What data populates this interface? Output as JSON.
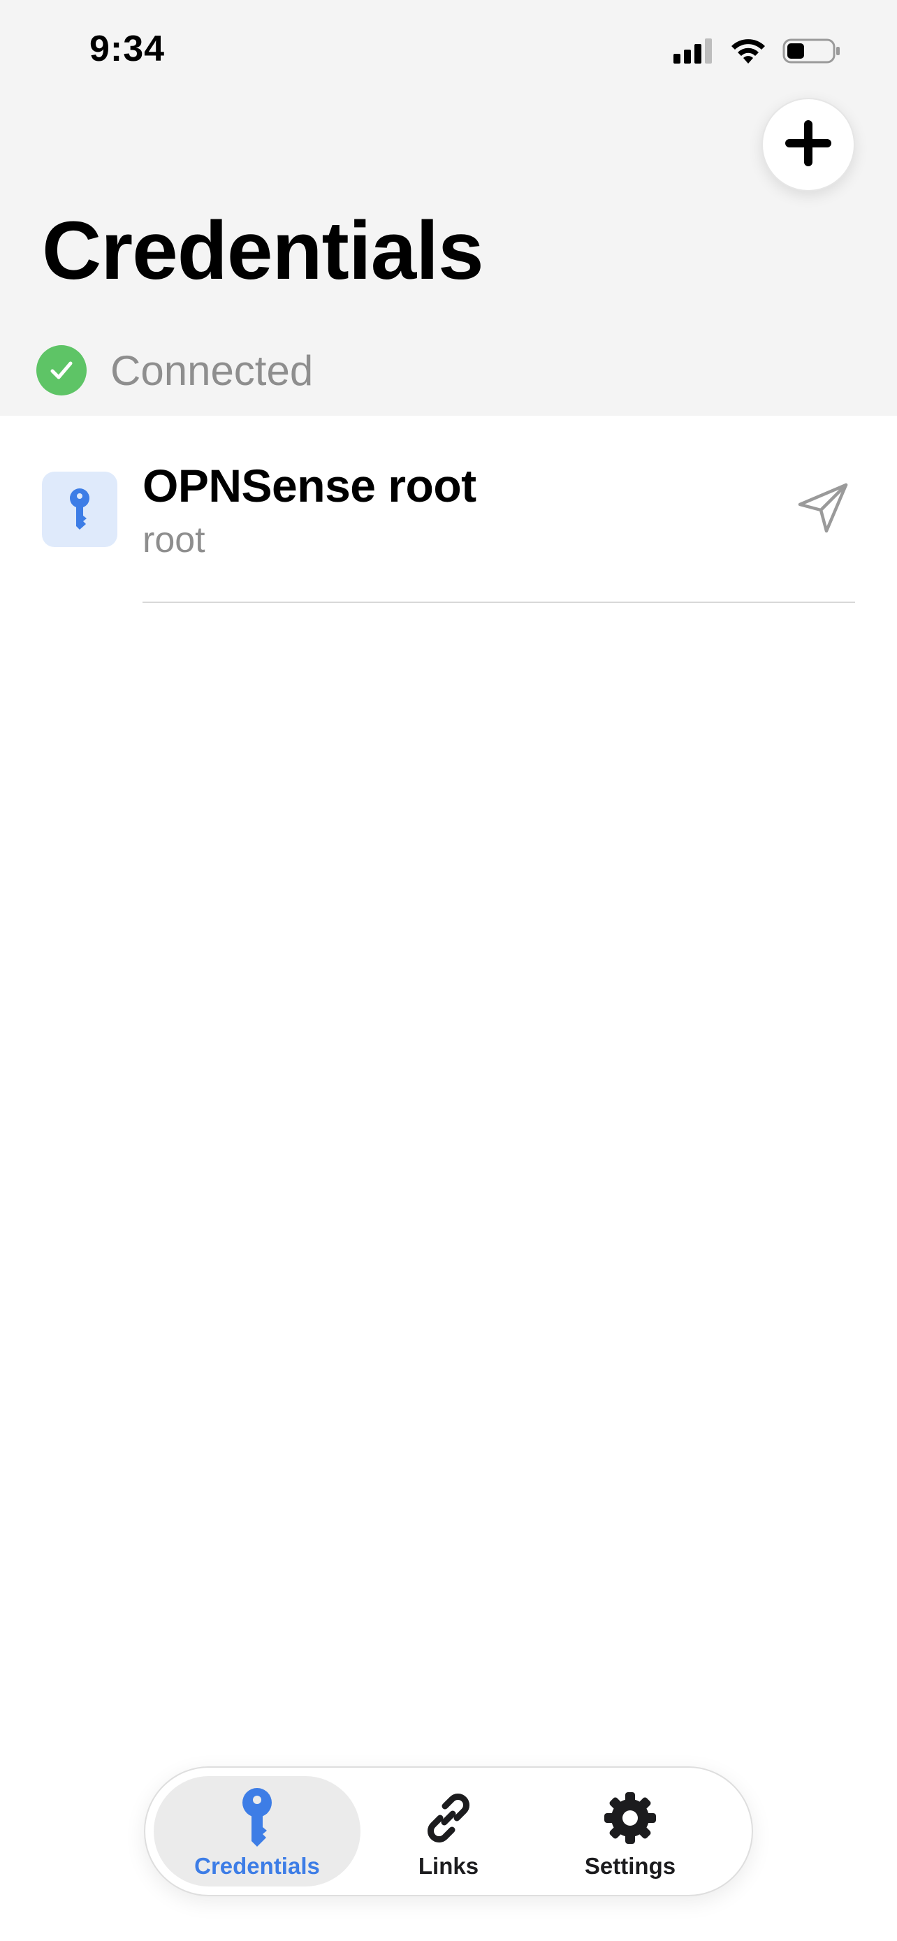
{
  "status_bar": {
    "time": "9:34"
  },
  "header": {
    "title": "Credentials",
    "connection_status": "Connected",
    "add_icon": "plus-icon"
  },
  "credentials": [
    {
      "title": "OPNSense root",
      "username": "root",
      "icon": "key-icon",
      "action_icon": "send-icon"
    }
  ],
  "tab_bar": {
    "tabs": [
      {
        "label": "Credentials",
        "icon": "key-icon",
        "active": true
      },
      {
        "label": "Links",
        "icon": "link-icon",
        "active": false
      },
      {
        "label": "Settings",
        "icon": "gear-icon",
        "active": false
      }
    ]
  },
  "colors": {
    "accent": "#3d7de6",
    "connected": "#5ec466",
    "header_bg": "#f4f4f4",
    "key_tile_bg": "#dfeafb"
  }
}
